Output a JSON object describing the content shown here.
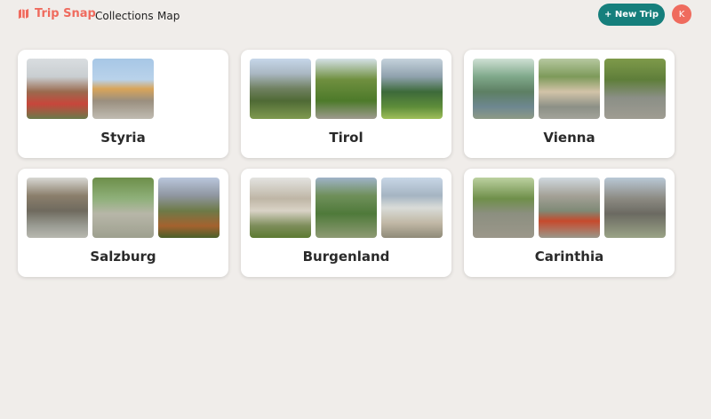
{
  "app": {
    "brand": "Trip Snap",
    "brand_color": "#ef6b5e",
    "accent_color": "#167f7c"
  },
  "nav": {
    "collections": "Collections",
    "map": "Map"
  },
  "actions": {
    "new_trip": "+ New Trip"
  },
  "user": {
    "initial": "K"
  },
  "collections": [
    {
      "name": "Styria",
      "photo_count": 2
    },
    {
      "name": "Tirol",
      "photo_count": 3
    },
    {
      "name": "Vienna",
      "photo_count": 3
    },
    {
      "name": "Salzburg",
      "photo_count": 3
    },
    {
      "name": "Burgenland",
      "photo_count": 3
    },
    {
      "name": "Carinthia",
      "photo_count": 3
    }
  ]
}
